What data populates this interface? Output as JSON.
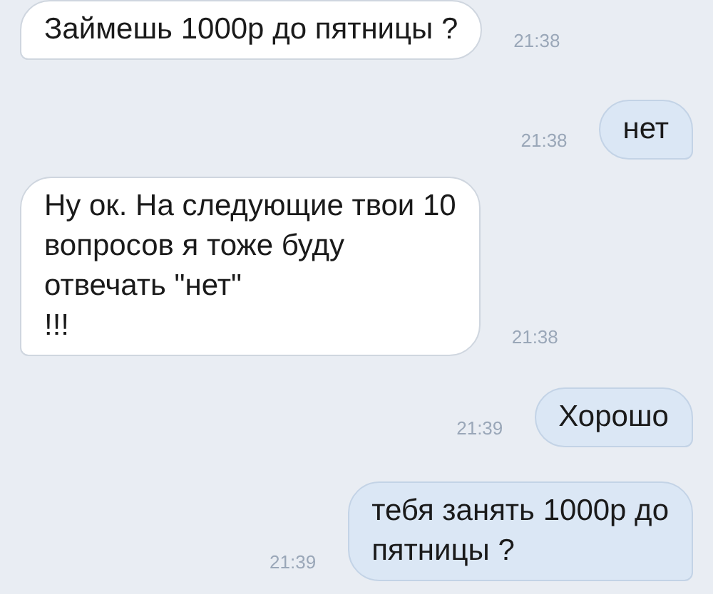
{
  "messages": [
    {
      "kind": "incoming",
      "text": "Займешь 1000р до пятницы ?",
      "time": "21:38"
    },
    {
      "kind": "outgoing",
      "text": "нет",
      "time": "21:38"
    },
    {
      "kind": "incoming",
      "text": "Ну ок. На следующие твои 10\nвопросов я тоже буду\nотвечать \"нет\"\n!!!",
      "time": "21:38"
    },
    {
      "kind": "outgoing",
      "text": "Хорошо",
      "time": "21:39"
    },
    {
      "kind": "outgoing",
      "text": "тебя занять 1000р до\nпятницы ?",
      "time": "21:39"
    }
  ]
}
